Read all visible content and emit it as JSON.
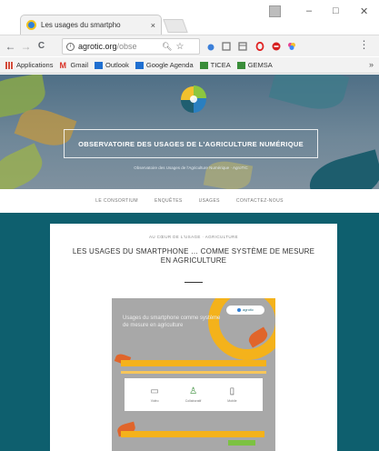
{
  "browser": {
    "tab_title": "Les usages du smartpho",
    "tab_close": "×",
    "window_controls": {
      "minimize": "–",
      "maximize": "□",
      "close": "✕"
    },
    "nav": {
      "back": "←",
      "forward": "→",
      "reload": "C"
    },
    "url_host": "agrotic.org",
    "url_path": "/obse",
    "bookmarks": [
      {
        "label": "Applications",
        "icon": "apps-grid-icon",
        "color": "#d24b3a"
      },
      {
        "label": "Gmail",
        "icon": "gmail-icon",
        "color": "#d93025"
      },
      {
        "label": "Outlook",
        "icon": "outlook-icon",
        "color": "#1f6fd0"
      },
      {
        "label": "Google Agenda",
        "icon": "calendar-icon",
        "color": "#1f6fd0"
      },
      {
        "label": "TICEA",
        "icon": "folder-icon",
        "color": "#3a8d3a"
      },
      {
        "label": "GEMSA",
        "icon": "folder-icon",
        "color": "#3a8d3a"
      }
    ],
    "bookmarks_more": "»"
  },
  "hero": {
    "title": "OBSERVATOIRE DES USAGES DE L'AGRICULTURE NUMÉRIQUE",
    "subtitle": "Observatoire des Usages de l'Agriculture Numérique · AgroTIC"
  },
  "nav_links": [
    "LE CONSORTIUM",
    "ENQUÊTES",
    "USAGES",
    "CONTACTEZ-NOUS"
  ],
  "article": {
    "kicker": "AU CŒUR DE L'USAGE · AGRICULTURE",
    "title": "LES USAGES DU SMARTPHONE … COMME SYSTÈME DE MESURE EN AGRICULTURE",
    "infographic": {
      "text": "Usages du smartphone comme système de mesure en agriculture",
      "badge": "agrotic",
      "panel_labels": [
        "Vidéo",
        "Collaboratif",
        "Mobile"
      ]
    }
  },
  "colors": {
    "teal": "#0e5f6e",
    "accent_yellow": "#f4b21b",
    "accent_orange": "#e0652b",
    "accent_green": "#7cc242"
  }
}
